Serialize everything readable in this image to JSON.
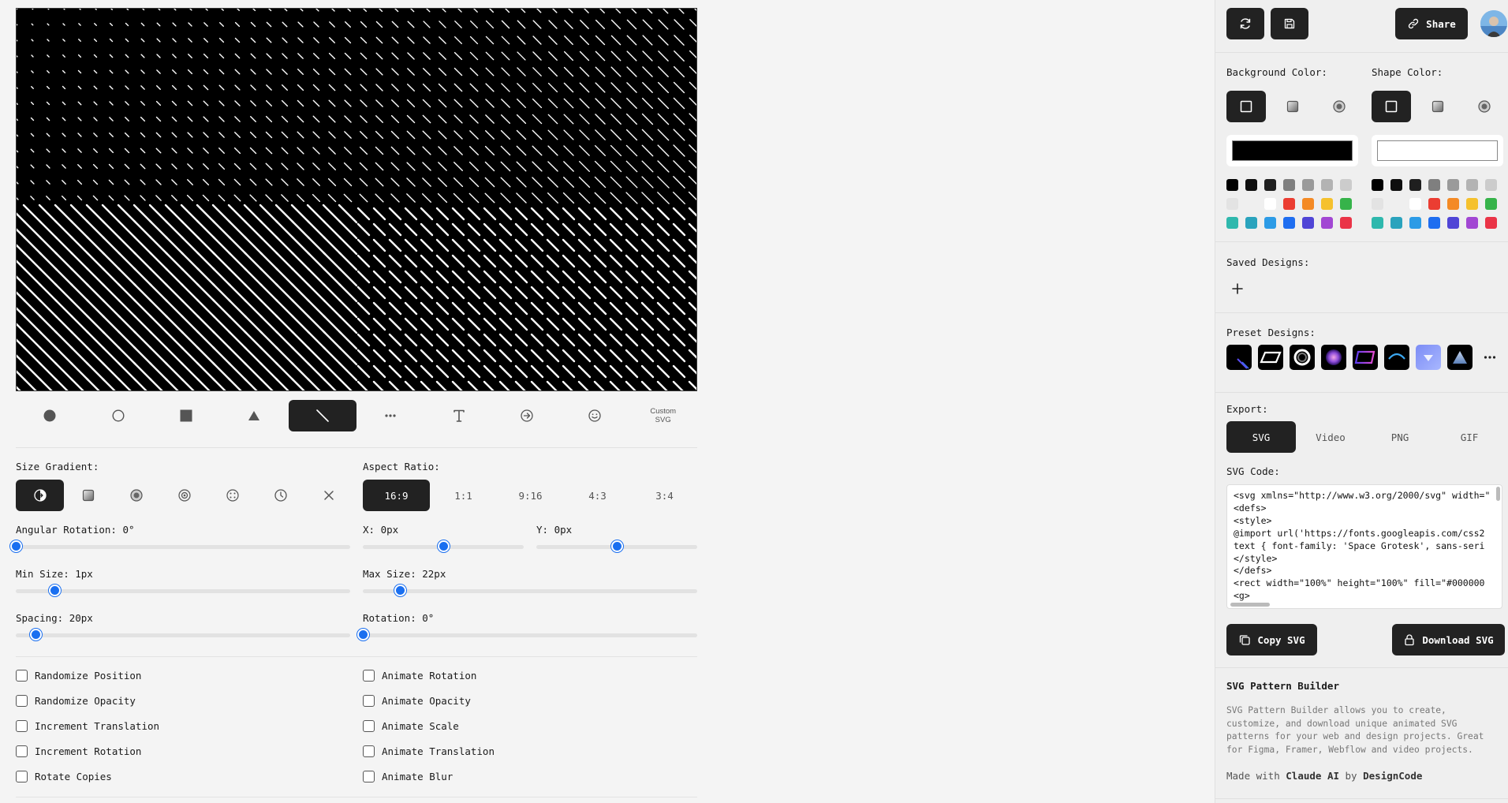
{
  "canvas": {
    "background": "#000000",
    "shape_color": "#ffffff"
  },
  "shape_toolbar": {
    "items": [
      {
        "name": "filled-circle-icon"
      },
      {
        "name": "outline-circle-icon"
      },
      {
        "name": "square-icon"
      },
      {
        "name": "triangle-icon"
      },
      {
        "name": "line-icon",
        "active": true
      },
      {
        "name": "dots-icon"
      },
      {
        "name": "text-icon"
      },
      {
        "name": "arrow-circle-icon"
      },
      {
        "name": "smiley-icon"
      },
      {
        "name": "custom-svg",
        "label": "Custom\nSVG"
      }
    ]
  },
  "size_gradient": {
    "label": "Size Gradient:",
    "options": [
      "half-circle-icon",
      "gradient-square-icon",
      "radial-dot-icon",
      "target-icon",
      "dots-grid-icon",
      "clock-icon",
      "close-icon"
    ],
    "active_index": 0
  },
  "aspect_ratio": {
    "label": "Aspect Ratio:",
    "options": [
      "16:9",
      "1:1",
      "9:16",
      "4:3",
      "3:4"
    ],
    "active": "16:9"
  },
  "sliders": {
    "angular_rotation": {
      "label": "Angular Rotation: 0°",
      "value": 0
    },
    "x": {
      "label": "X: 0px",
      "value": 0.5
    },
    "y": {
      "label": "Y: 0px",
      "value": 0.5
    },
    "min_size": {
      "label": "Min Size: 1px",
      "value": 0.115
    },
    "max_size": {
      "label": "Max Size: 22px",
      "value": 0.11
    },
    "spacing": {
      "label": "Spacing: 20px",
      "value": 0.06
    },
    "rotation": {
      "label": "Rotation: 0°",
      "value": 0
    }
  },
  "checkboxes_left": [
    "Randomize Position",
    "Randomize Opacity",
    "Increment Translation",
    "Increment Rotation",
    "Rotate Copies"
  ],
  "checkboxes_right": [
    "Animate Rotation",
    "Animate Opacity",
    "Animate Scale",
    "Animate Translation",
    "Animate Blur"
  ],
  "panel": {
    "share_label": "Share",
    "background_color_label": "Background Color:",
    "shape_color_label": "Shape Color:",
    "background_color_value": "#000000",
    "shape_color_value": "#ffffff",
    "palette": [
      "#000000",
      "#0e0e0e",
      "#1f1f1f",
      "#7f7f7f",
      "#9a9a9a",
      "#b3b3b3",
      "#cccccc",
      "#e3e3e3",
      "#efefef",
      "#ffffff",
      "#eb3d32",
      "#f48a25",
      "#f5c12d",
      "#36b34a",
      "#2fb8ad",
      "#2aa3bd",
      "#2c9be6",
      "#1f6ef0",
      "#5045d6",
      "#a247d3",
      "#ea3447"
    ],
    "saved_designs_label": "Saved Designs:",
    "preset_designs_label": "Preset Designs:",
    "presets": [
      "preset-lines",
      "preset-parallelogram",
      "preset-ring",
      "preset-orb",
      "preset-gradient-shape",
      "preset-arc",
      "preset-glow",
      "preset-triangle"
    ],
    "export_label": "Export:",
    "export_tabs": [
      "SVG",
      "Video",
      "PNG",
      "GIF"
    ],
    "export_active": "SVG",
    "svg_code_label": "SVG Code:",
    "svg_code": "<svg xmlns=\"http://www.w3.org/2000/svg\" width=\"\n<defs>\n<style>\n@import url('https://fonts.googleapis.com/css2\ntext { font-family: 'Space Grotesk', sans-seri\n</style>\n</defs>\n<rect width=\"100%\" height=\"100%\" fill=\"#000000\n<g>",
    "copy_svg_label": "Copy SVG",
    "download_svg_label": "Download SVG",
    "about_title": "SVG Pattern Builder",
    "about_text": "SVG Pattern Builder allows you to create, customize, and download unique animated SVG patterns for your web and design projects. Great for Figma, Framer, Webflow and video projects.",
    "made_with_prefix": "Made with",
    "made_with_ai": "Claude AI",
    "made_with_by": "by",
    "made_with_brand": "DesignCode"
  }
}
